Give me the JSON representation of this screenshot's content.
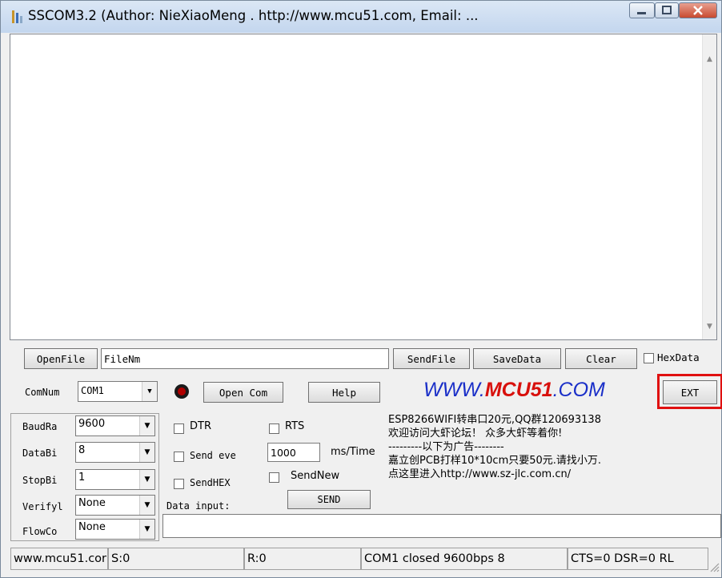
{
  "window": {
    "title": "SSCOM3.2 (Author: NieXiaoMeng . http://www.mcu51.com, Email: ..."
  },
  "caption_buttons": {
    "minimize": "—",
    "maximize": "□",
    "close": "X"
  },
  "file_row": {
    "open_file": "OpenFile",
    "file_name": "FileNm",
    "send_file": "SendFile",
    "save_data": "SaveData",
    "clear": "Clear",
    "hex_data": "HexData"
  },
  "com_row": {
    "com_num_label": "ComNum",
    "com_num_value": "COM1",
    "open_com": "Open Com",
    "help": "Help",
    "logo_prefix": "WWW.",
    "logo_brand": "MCU51",
    "logo_suffix": ".COM",
    "ext": "EXT"
  },
  "settings": {
    "baud_label": "BaudRa",
    "baud_value": "9600",
    "databits_label": "DataBi",
    "databits_value": "8",
    "stopbits_label": "StopBi",
    "stopbits_value": "1",
    "verify_label": "Verifyl",
    "verify_value": "None",
    "flow_label": "FlowCo",
    "flow_value": "None"
  },
  "options": {
    "dtr": "DTR",
    "rts": "RTS",
    "send_every": "Send eve",
    "interval_value": "1000",
    "interval_unit": "ms/Time",
    "send_hex": "SendHEX",
    "send_new": "SendNew",
    "data_input_label": "Data input:",
    "send_button": "SEND"
  },
  "ad_lines": [
    "ESP8266WIFI转串口20元,QQ群120693138",
    "欢迎访问大虾论坛！ 众多大虾等着你!",
    "---------以下为广告--------",
    "嘉立创PCB打样10*10cm只要50元.请找小万.",
    "点这里进入http://www.sz-jlc.com.cn/"
  ],
  "status_bar": {
    "website": "www.mcu51.cor",
    "sent": "S:0",
    "received": "R:0",
    "port_state": "COM1 closed  9600bps  8",
    "signals": "CTS=0 DSR=0 RL"
  },
  "colors": {
    "logo_blue": "#1a2fc8",
    "logo_red": "#d8100c",
    "highlight_red": "#e01010",
    "led": "#b00000"
  }
}
